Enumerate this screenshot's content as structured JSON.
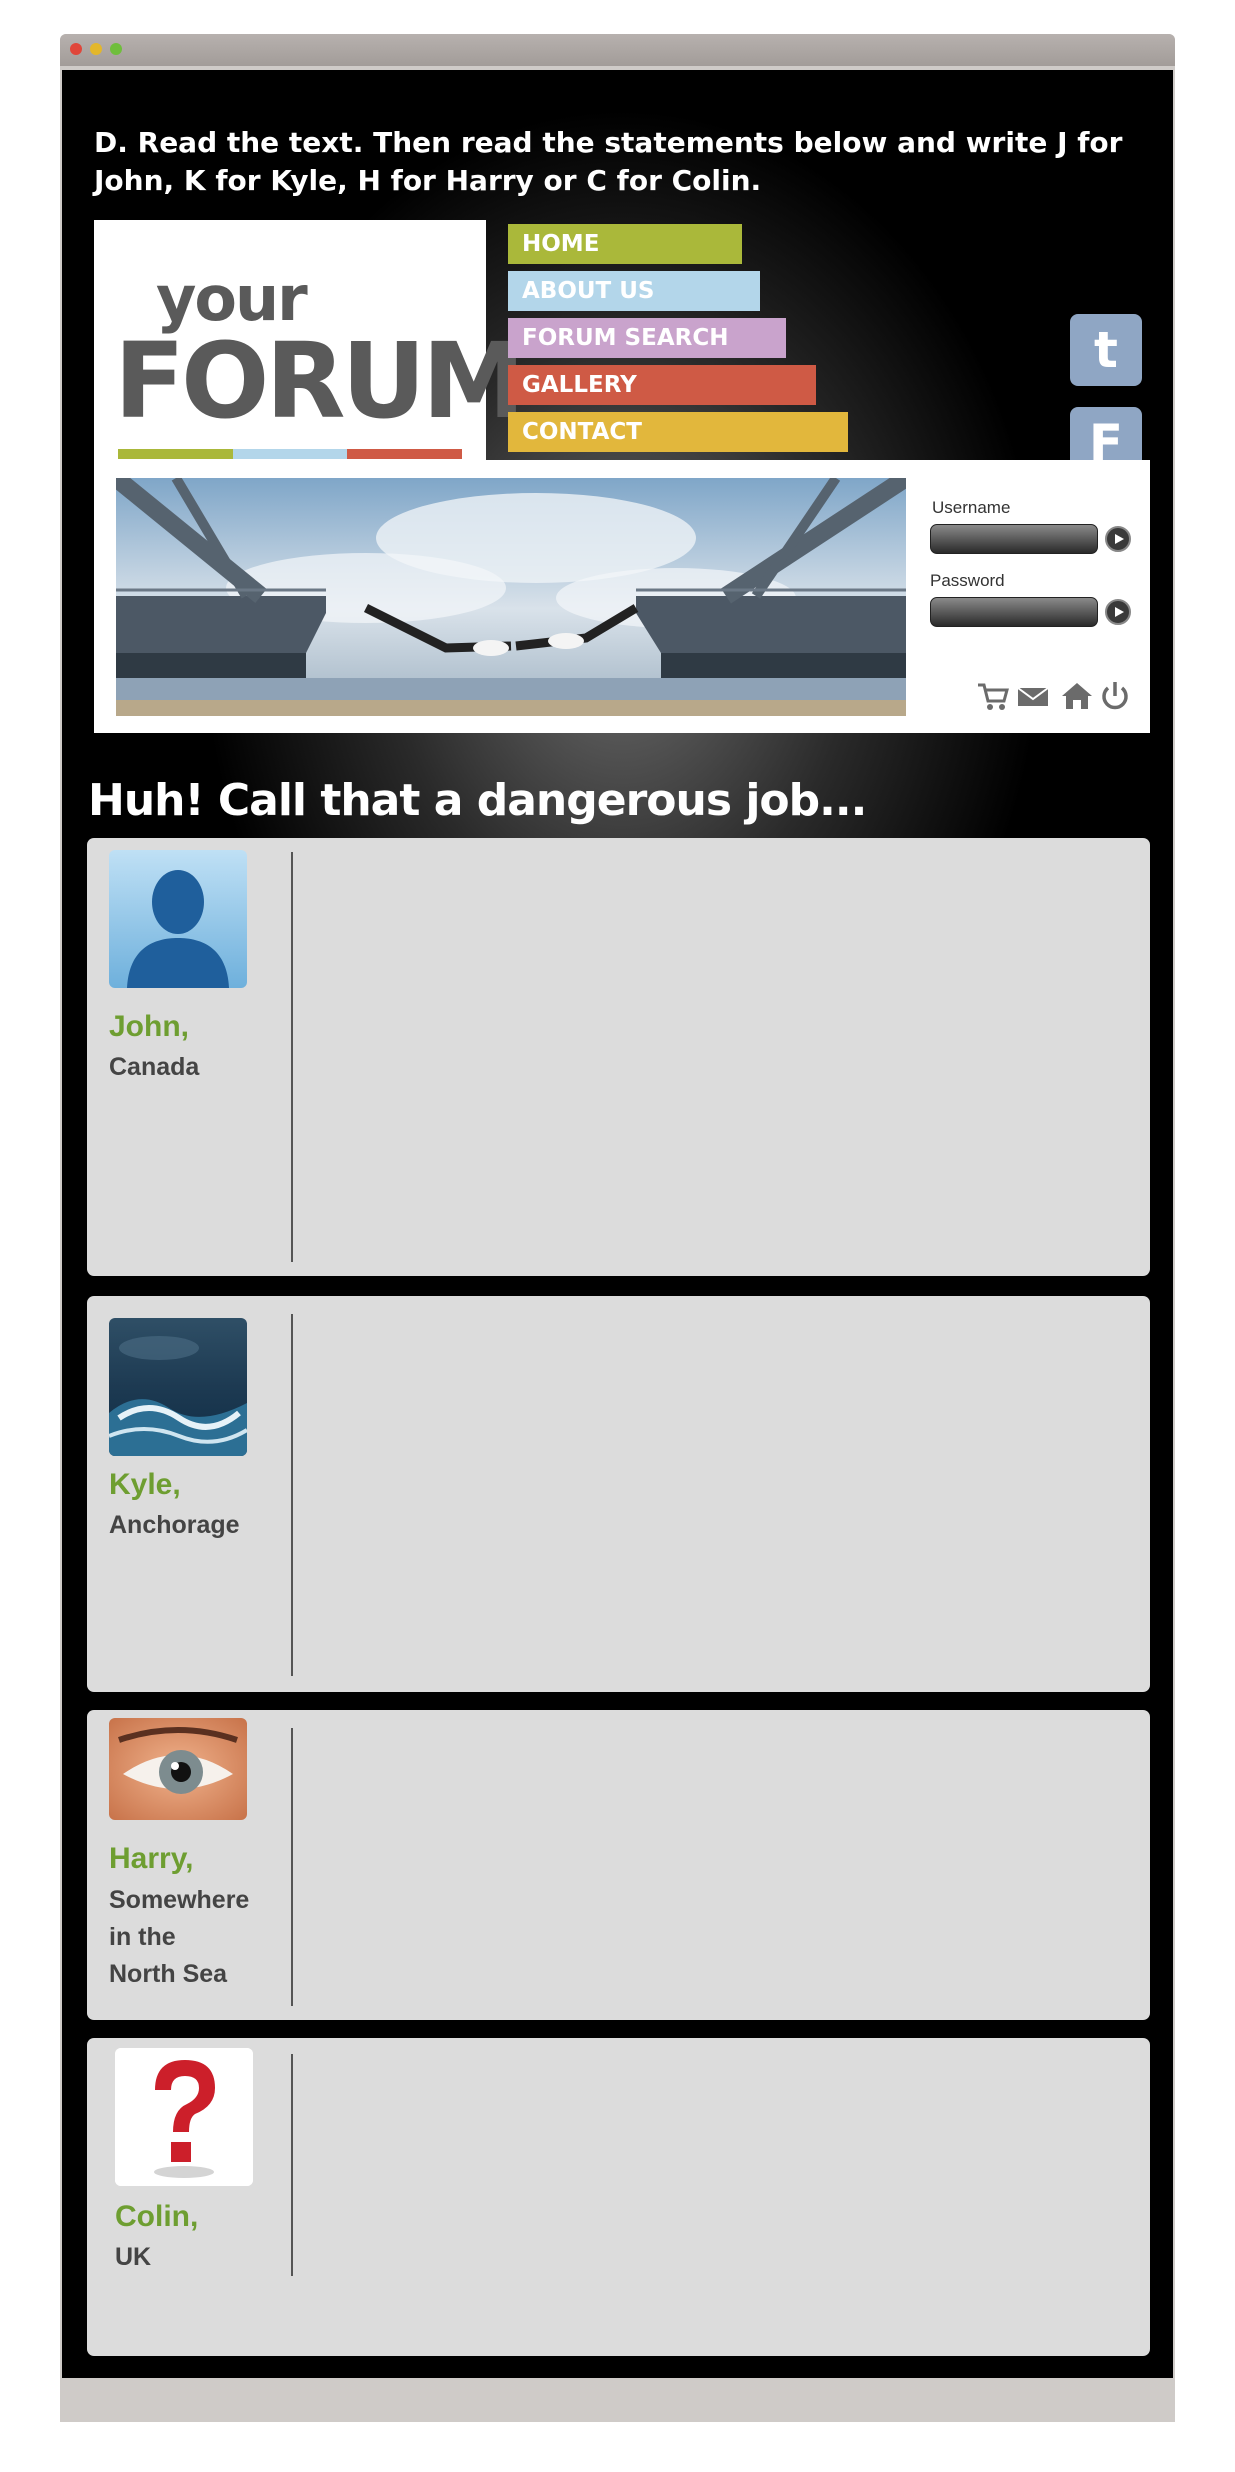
{
  "instruction": {
    "line1": "D. Read the text. Then read the statements below and write J for",
    "line2": "John, K for Kyle, H for Harry or C for Colin."
  },
  "logo": {
    "your": "your",
    "forum": "FORUM",
    "bar_colors": [
      "#aab83a",
      "#b3d6ea",
      "#cf5a45"
    ]
  },
  "nav": [
    {
      "label": "HOME",
      "color": "#aab83a"
    },
    {
      "label": "ABOUT US",
      "color": "#b3d6ea"
    },
    {
      "label": "FORUM SEARCH",
      "color": "#c9a3cc"
    },
    {
      "label": "GALLERY",
      "color": "#cf5a45"
    },
    {
      "label": "CONTACT",
      "color": "#e2b73c"
    }
  ],
  "social": {
    "tumblr": "t",
    "facebook": "F"
  },
  "login": {
    "username_label": "Username",
    "password_label": "Password"
  },
  "utility_icons": [
    "cart-icon",
    "mail-icon",
    "home-icon",
    "power-icon"
  ],
  "forum_title": "Huh! Call that a dangerous job...",
  "posts": [
    {
      "name": "John,",
      "place": "Canada",
      "avatar": "silhouette-avatar"
    },
    {
      "name": "Kyle,",
      "place": "Anchorage",
      "avatar": "stormy-sea-avatar"
    },
    {
      "name": "Harry,",
      "place_lines": [
        "Somewhere",
        "in the",
        "North Sea"
      ],
      "avatar": "eye-avatar"
    },
    {
      "name": "Colin,",
      "place": "UK",
      "avatar": "question-mark-avatar"
    }
  ],
  "colors": {
    "accent_green": "#6e9e31",
    "post_bg": "#dcdcdc"
  }
}
